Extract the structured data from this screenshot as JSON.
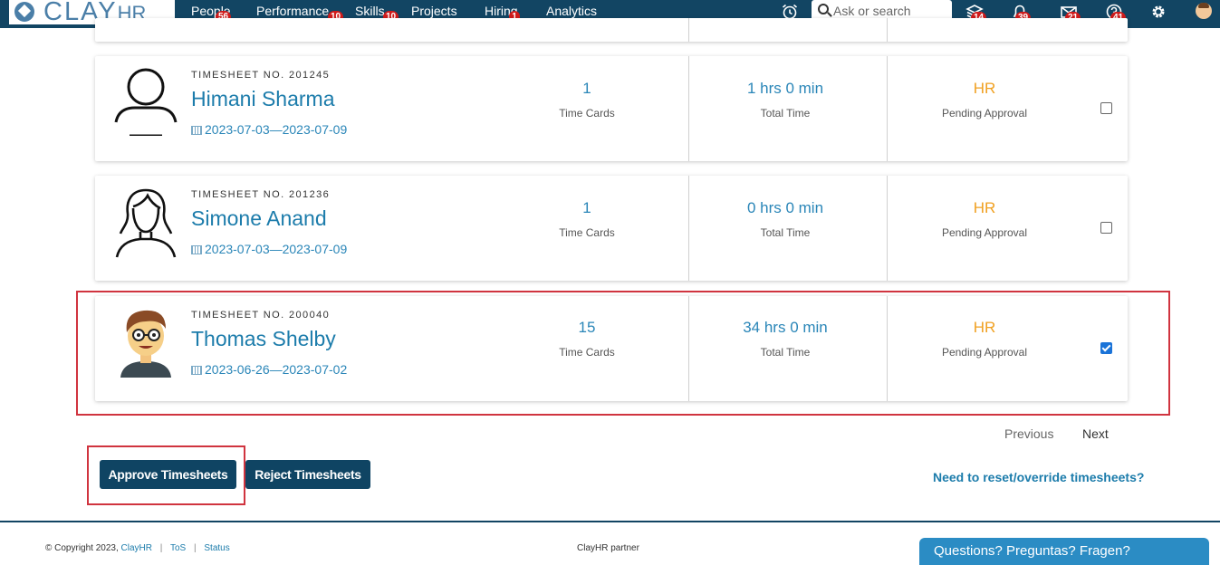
{
  "app": {
    "logo_main": "CLAY",
    "logo_sub": "HR"
  },
  "nav": [
    {
      "label": "People",
      "badge": "56",
      "active": true
    },
    {
      "label": "Performance",
      "badge": "10"
    },
    {
      "label": "Skills",
      "badge": "10"
    },
    {
      "label": "Projects",
      "badge": ""
    },
    {
      "label": "Hiring",
      "badge": "1"
    },
    {
      "label": "Analytics",
      "badge": ""
    }
  ],
  "search": {
    "placeholder": "Ask or search"
  },
  "header_icons": [
    {
      "name": "alarm-clock-icon",
      "badge": ""
    },
    {
      "name": "inbox-stack-icon",
      "badge": "14"
    },
    {
      "name": "bell-icon",
      "badge": "39"
    },
    {
      "name": "mail-icon",
      "badge": "21"
    },
    {
      "name": "help-icon",
      "badge": "41"
    },
    {
      "name": "gear-icon",
      "badge": ""
    },
    {
      "name": "user-avatar-icon",
      "badge": ""
    }
  ],
  "timesheets": [
    {
      "timesheet_no": "TIMESHEET NO. 201245",
      "name": "Himani Sharma",
      "period": "2023-07-03—2023-07-09",
      "time_cards": "1",
      "time_cards_label": "Time Cards",
      "total_time": "1 hrs 0 min",
      "total_time_label": "Total Time",
      "approver": "HR",
      "status": "Pending Approval",
      "checked": false,
      "avatar": "generic-male-outline"
    },
    {
      "timesheet_no": "TIMESHEET NO. 201236",
      "name": "Simone Anand",
      "period": "2023-07-03—2023-07-09",
      "time_cards": "1",
      "time_cards_label": "Time Cards",
      "total_time": "0 hrs 0 min",
      "total_time_label": "Total Time",
      "approver": "HR",
      "status": "Pending Approval",
      "checked": false,
      "avatar": "generic-female-outline"
    },
    {
      "timesheet_no": "TIMESHEET NO. 200040",
      "name": "Thomas Shelby",
      "period": "2023-06-26—2023-07-02",
      "time_cards": "15",
      "time_cards_label": "Time Cards",
      "total_time": "34 hrs 0 min",
      "total_time_label": "Total Time",
      "approver": "HR",
      "status": "Pending Approval",
      "checked": true,
      "avatar": "cartoon-man-glasses"
    }
  ],
  "pagination": {
    "previous": "Previous",
    "next": "Next"
  },
  "actions": {
    "approve": "Approve Timesheets",
    "reject": "Reject Timesheets",
    "reset_link": "Need to reset/override timesheets?"
  },
  "footer": {
    "copyright": "© Copyright 2023,",
    "brand_link": "ClayHR",
    "tos": "ToS",
    "status": "Status",
    "partner": "ClayHR partner",
    "help": "Questions? Preguntas? Fragen?"
  },
  "colors": {
    "header": "#124563",
    "link": "#1c7cab",
    "orange": "#f0a020",
    "highlight": "#d0343f",
    "badge": "#d11b1b"
  }
}
